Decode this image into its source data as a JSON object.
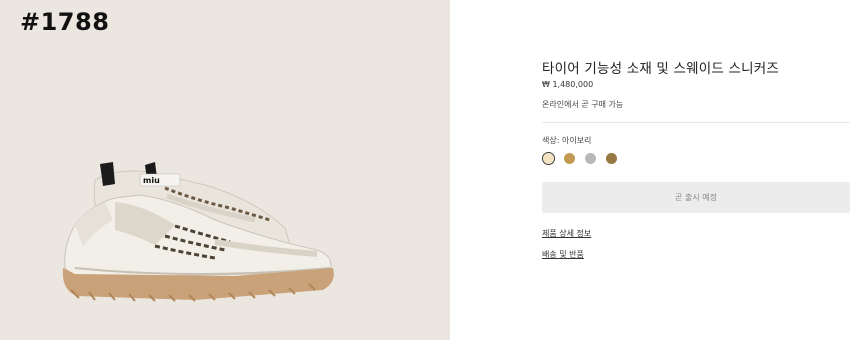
{
  "post": {
    "number": "#1788"
  },
  "product": {
    "image_alt": "white sneaker pair with gum sole",
    "title": "타이어 기능성 소재 및 스웨이드 스니커즈",
    "price": "₩ 1,480,000",
    "availability": "온라인에서 곧 구매 가능",
    "color_label": "색상:",
    "color_value": "아이보리",
    "swatches": [
      {
        "name": "ivory",
        "color": "#f3e3c3",
        "selected": true
      },
      {
        "name": "camel",
        "color": "#c49a52",
        "selected": false
      },
      {
        "name": "grey",
        "color": "#b8b8b8",
        "selected": false
      },
      {
        "name": "brown",
        "color": "#967841",
        "selected": false
      }
    ],
    "coming_soon_label": "곧 출시 예정",
    "links": {
      "details": "제품 상세 정보",
      "shipping": "배송 및 반품"
    }
  }
}
